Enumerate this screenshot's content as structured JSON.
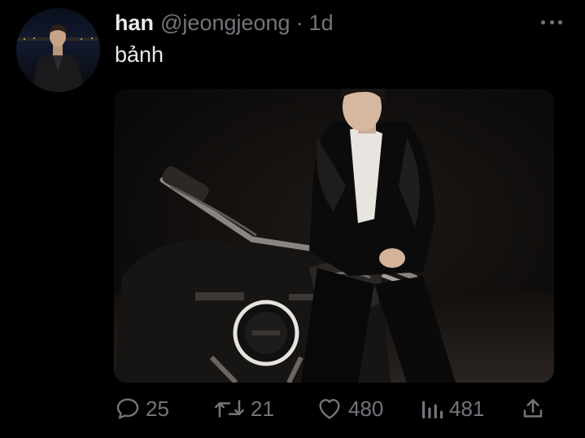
{
  "tweet": {
    "display_name": "han",
    "handle": "@jeongjeong",
    "separator": "·",
    "time": "1d",
    "text": "bảnh"
  },
  "actions": {
    "reply_count": "25",
    "retweet_count": "21",
    "like_count": "480",
    "view_count": "481"
  },
  "icons": {
    "more": "more-horizontal-icon",
    "reply": "reply-icon",
    "retweet": "retweet-icon",
    "like": "heart-icon",
    "views": "views-icon",
    "share": "share-icon"
  },
  "colors": {
    "background": "#000000",
    "primary_text": "#e7e9ea",
    "secondary_text": "#71767b"
  }
}
